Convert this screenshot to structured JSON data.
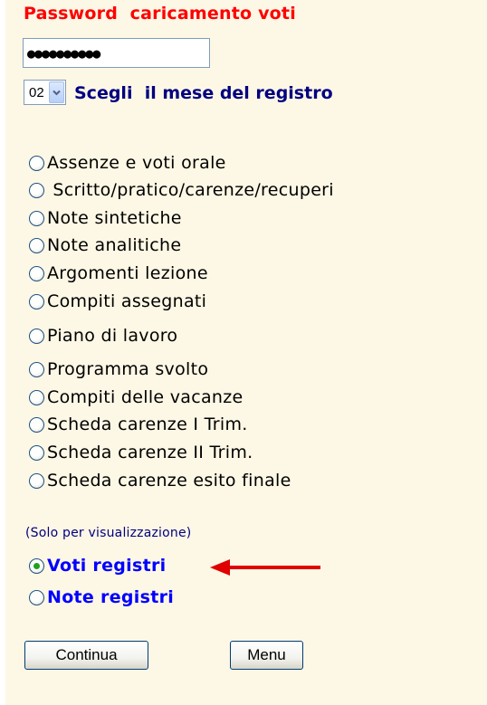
{
  "form": {
    "title": "Password  caricamento voti",
    "password_value": "●●●●●●●●●●",
    "month": {
      "selected": "02",
      "label": "Scegli  il mese del registro"
    },
    "options": [
      {
        "label": "Assenze e voti orale",
        "checked": false
      },
      {
        "label": " Scritto/pratico/carenze/recuperi",
        "checked": false
      },
      {
        "label": "Note sintetiche",
        "checked": false
      },
      {
        "label": "Note analitiche",
        "checked": false
      },
      {
        "label": "Argomenti lezione",
        "checked": false
      },
      {
        "label": "Compiti assegnati",
        "checked": false
      },
      {
        "label": "Piano di lavoro",
        "checked": false
      },
      {
        "label": "Programma svolto",
        "checked": false
      },
      {
        "label": "Compiti delle vacanze",
        "checked": false
      },
      {
        "label": "Scheda carenze I Trim.",
        "checked": false
      },
      {
        "label": "Scheda carenze II Trim.",
        "checked": false
      },
      {
        "label": "Scheda carenze esito finale",
        "checked": false
      }
    ],
    "view_only_note": "(Solo per visualizzazione)",
    "view_options": [
      {
        "label": "Voti registri",
        "checked": true
      },
      {
        "label": "Note registri",
        "checked": false
      }
    ],
    "buttons": {
      "continue_label": "Continua",
      "menu_label": "Menu"
    }
  },
  "colors": {
    "title": "#ff0000",
    "month_label": "#000080",
    "view_option": "#0000ff",
    "panel_bg": "#fdf7e5",
    "arrow": "#e00000"
  },
  "icons": {
    "dropdown": "chevron-down-icon",
    "arrow": "arrow-left-icon"
  }
}
